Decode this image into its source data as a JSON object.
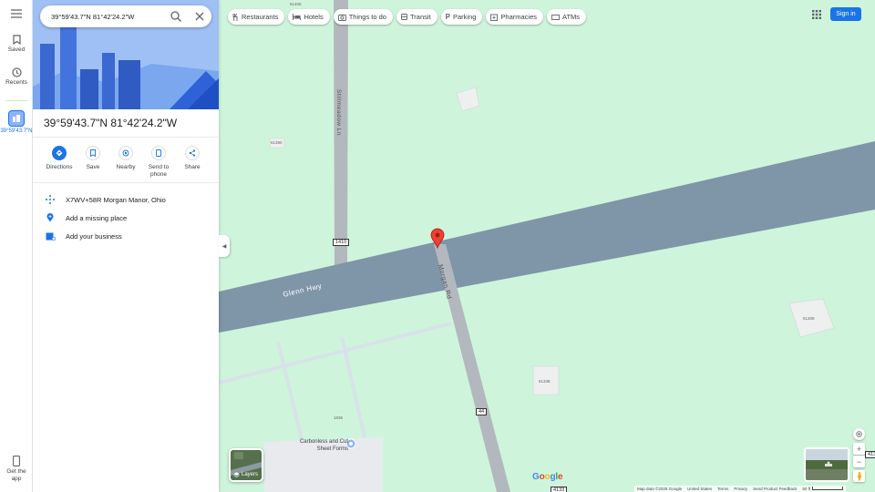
{
  "search": {
    "value": "39°59'43.7\"N 81°42'24.2\"W"
  },
  "rail": {
    "saved_label": "Saved",
    "recents_label": "Recents",
    "recent_place_label": "39°59'43.7\"N",
    "get_app_label": "Get the app"
  },
  "place": {
    "title": "39°59'43.7\"N 81°42'24.2\"W",
    "actions": [
      {
        "label": "Directions"
      },
      {
        "label": "Save"
      },
      {
        "label": "Nearby"
      },
      {
        "label": "Send to phone"
      },
      {
        "label": "Share"
      }
    ],
    "plus_code": "X7WV+58R Morgan Manor, Ohio",
    "add_place": "Add a missing place",
    "add_business": "Add your business"
  },
  "chips": [
    {
      "label": "Restaurants",
      "icon": "restaurant-icon"
    },
    {
      "label": "Hotels",
      "icon": "hotel-icon"
    },
    {
      "label": "Things to do",
      "icon": "camera-icon"
    },
    {
      "label": "Transit",
      "icon": "transit-icon"
    },
    {
      "label": "Parking",
      "icon": "parking-icon"
    },
    {
      "label": "Pharmacies",
      "icon": "pharmacy-icon"
    },
    {
      "label": "ATMs",
      "icon": "atm-icon"
    }
  ],
  "header": {
    "signin_label": "Sign in"
  },
  "map": {
    "roads": {
      "highway_name": "Glenn Hwy",
      "side_road": "Morgan Rd",
      "north_road": "Stillmeadow Ln"
    },
    "shields": [
      "1410",
      "44",
      "4133",
      "413"
    ],
    "parcel_labels": [
      "61406",
      "61380",
      "61308",
      "61338",
      "1836"
    ],
    "poi": "Carbonless and Cut Sheet Forms"
  },
  "layers_label": "Layers",
  "footer": {
    "map_data": "Map data ©2025 Google",
    "country": "United States",
    "terms": "Terms",
    "privacy": "Privacy",
    "feedback": "Send Product Feedback",
    "scale": "50 ft"
  },
  "logo": "Google",
  "colors": {
    "map_bg": "#cef5dc",
    "highway": "#7f95a8",
    "accent": "#1a73e8",
    "pin": "#ea4335"
  }
}
